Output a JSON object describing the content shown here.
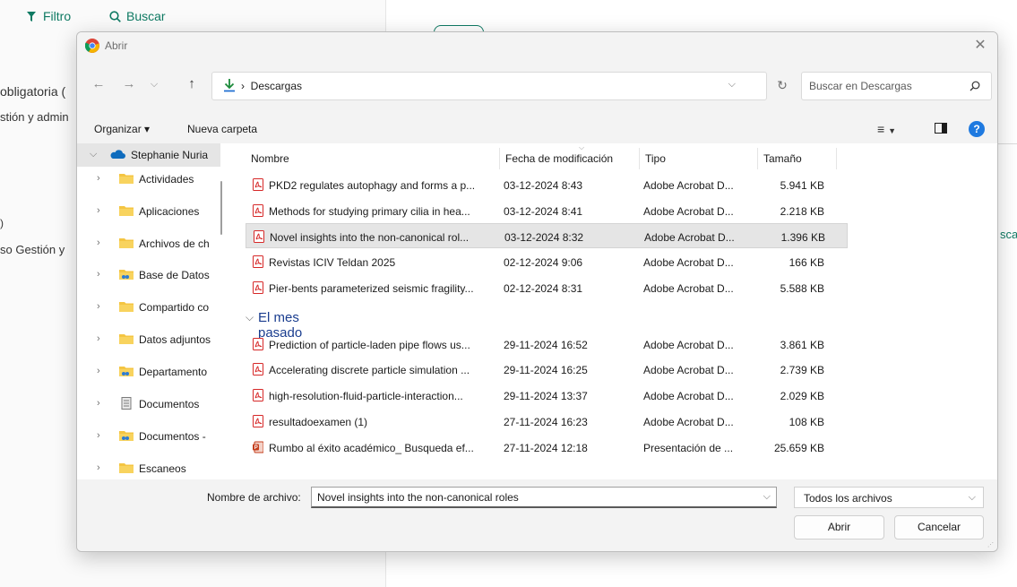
{
  "background_app": {
    "filter_label": "Filtro",
    "search_label": "Buscar",
    "left_text_1": "obligatoria (",
    "left_text_2": "stión y admin",
    "left_text_3": ")",
    "left_text_4": "so Gestión y",
    "right_text_1": "sca"
  },
  "dialog": {
    "title": "Abrir",
    "address_path": "Descargas",
    "search_placeholder": "Buscar en Descargas",
    "toolbar": {
      "organize_label": "Organizar ▾",
      "new_folder_label": "Nueva carpeta"
    },
    "nav_pane": {
      "items": [
        {
          "label": "Stephanie Nuria",
          "icon": "onedrive-cloud-icon",
          "expanded": true
        },
        {
          "label": "Actividades",
          "icon": "folder-icon"
        },
        {
          "label": "Aplicaciones",
          "icon": "folder-icon"
        },
        {
          "label": "Archivos de ch",
          "icon": "folder-icon"
        },
        {
          "label": "Base de Datos",
          "icon": "shared-folder-icon"
        },
        {
          "label": "Compartido co",
          "icon": "folder-icon"
        },
        {
          "label": "Datos adjuntos",
          "icon": "folder-icon"
        },
        {
          "label": "Departamento",
          "icon": "shared-folder-icon"
        },
        {
          "label": "Documentos",
          "icon": "documents-icon"
        },
        {
          "label": "Documentos -",
          "icon": "shared-folder-icon"
        },
        {
          "label": "Escaneos",
          "icon": "folder-icon"
        }
      ]
    },
    "columns": {
      "name": "Nombre",
      "date": "Fecha de modificación",
      "type": "Tipo",
      "size": "Tamaño"
    },
    "files_recent": [
      {
        "name": "PKD2 regulates autophagy and forms a p...",
        "date": "03-12-2024 8:43",
        "type": "Adobe Acrobat D...",
        "size": "5.941 KB",
        "icon": "pdf-icon"
      },
      {
        "name": "Methods for studying primary cilia in hea...",
        "date": "03-12-2024 8:41",
        "type": "Adobe Acrobat D...",
        "size": "2.218 KB",
        "icon": "pdf-icon"
      },
      {
        "name": "Novel insights into the non-canonical rol...",
        "date": "03-12-2024 8:32",
        "type": "Adobe Acrobat D...",
        "size": "1.396 KB",
        "icon": "pdf-icon",
        "selected": true
      },
      {
        "name": "Revistas ICIV  Teldan 2025",
        "date": "02-12-2024 9:06",
        "type": "Adobe Acrobat D...",
        "size": "166 KB",
        "icon": "pdf-icon"
      },
      {
        "name": "Pier-bents parameterized seismic fragility...",
        "date": "02-12-2024 8:31",
        "type": "Adobe Acrobat D...",
        "size": "5.588 KB",
        "icon": "pdf-icon"
      }
    ],
    "group_last_month": "El mes pasado",
    "files_last_month": [
      {
        "name": "Prediction of particle-laden pipe flows us...",
        "date": "29-11-2024 16:52",
        "type": "Adobe Acrobat D...",
        "size": "3.861 KB",
        "icon": "pdf-icon"
      },
      {
        "name": "Accelerating discrete particle simulation ...",
        "date": "29-11-2024 16:25",
        "type": "Adobe Acrobat D...",
        "size": "2.739 KB",
        "icon": "pdf-icon"
      },
      {
        "name": "high-resolution-fluid-particle-interaction...",
        "date": "29-11-2024 13:37",
        "type": "Adobe Acrobat D...",
        "size": "2.029 KB",
        "icon": "pdf-icon"
      },
      {
        "name": "resultadoexamen (1)",
        "date": "27-11-2024 16:23",
        "type": "Adobe Acrobat D...",
        "size": "108 KB",
        "icon": "pdf-icon"
      },
      {
        "name": "Rumbo al éxito académico_ Busqueda ef...",
        "date": "27-11-2024 12:18",
        "type": "Presentación de ...",
        "size": "25.659 KB",
        "icon": "pptx-icon"
      }
    ],
    "filename_label": "Nombre de archivo:",
    "filename_value": "Novel insights into the non-canonical roles",
    "filetype_value": "Todos los archivos",
    "open_button": "Abrir",
    "cancel_button": "Cancelar"
  },
  "colors": {
    "accent_green": "#0f7a63",
    "selection_gray": "#e5e5e5",
    "pdf_red": "#d62828",
    "folder_yellow": "#f4c542",
    "help_blue": "#1f7ae0",
    "group_header_blue": "#1a3d8f"
  }
}
